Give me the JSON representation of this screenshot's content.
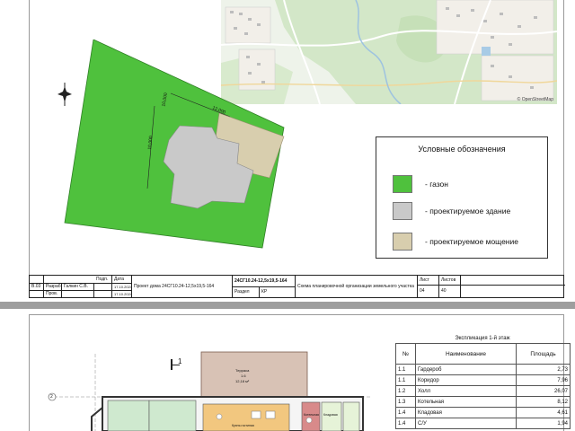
{
  "colors": {
    "lawn": "#4fc13d",
    "building": "#c9c9c9",
    "paving": "#d8ceae",
    "page_bg": "#9e9e9e"
  },
  "north_arrow_icon": "compass-star-icon",
  "site_plan": {
    "dim_top": "12,000",
    "dim_left": "10,000",
    "dim_west": "10,000"
  },
  "legend": {
    "title": "Условные обозначения",
    "items": [
      {
        "label": "- газон",
        "color": "#4fc13d"
      },
      {
        "label": "- проектируемое здание",
        "color": "#c9c9c9"
      },
      {
        "label": "- проектируемое мощение",
        "color": "#d8ceae"
      }
    ]
  },
  "map": {
    "attribution": "© OpenStreetMap"
  },
  "title_block": {
    "sheet_code": "В.03",
    "razrab": "Разраб.",
    "razrab_name": "Галкин С.В.",
    "prov": "Пров.",
    "podp": "Подп.",
    "date_label": "Дата",
    "date1": "17.10.2024",
    "date2": "17.10.2024",
    "project": "Проект дома 24СГ10.24-12,5х19,5-164",
    "code": "24СГ10.24-12,5х19,5-164",
    "razdel_label": "Раздел",
    "razdel": "КР",
    "sheet_title": "Схема планировочной организации земельного участка",
    "list_label": "Лист",
    "list_value": "04",
    "listov_label": "Листов",
    "listov_value": "40"
  },
  "floor_plan": {
    "section_mark": "1",
    "terrace_label": "Терраса",
    "terrace_num": "1.6",
    "terrace_area": "12,18 м²",
    "axis_marks": [
      "2",
      "1"
    ],
    "room_labels": [
      "Кухня-гостиная",
      "Котельная",
      "Кладовая"
    ]
  },
  "explication": {
    "caption": "Экспликация 1-й этаж",
    "headers": [
      "№",
      "Наименование",
      "Площадь"
    ],
    "rows": [
      {
        "num": "1.1",
        "name": "Гардероб",
        "area": "2,73"
      },
      {
        "num": "1.1",
        "name": "Коридор",
        "area": "7,96"
      },
      {
        "num": "1.2",
        "name": "Холл",
        "area": "26,07"
      },
      {
        "num": "1.3",
        "name": "Котельная",
        "area": "8,12"
      },
      {
        "num": "1.4",
        "name": "Кладовая",
        "area": "4,61"
      },
      {
        "num": "1.4",
        "name": "С/У",
        "area": "1,94"
      }
    ]
  }
}
